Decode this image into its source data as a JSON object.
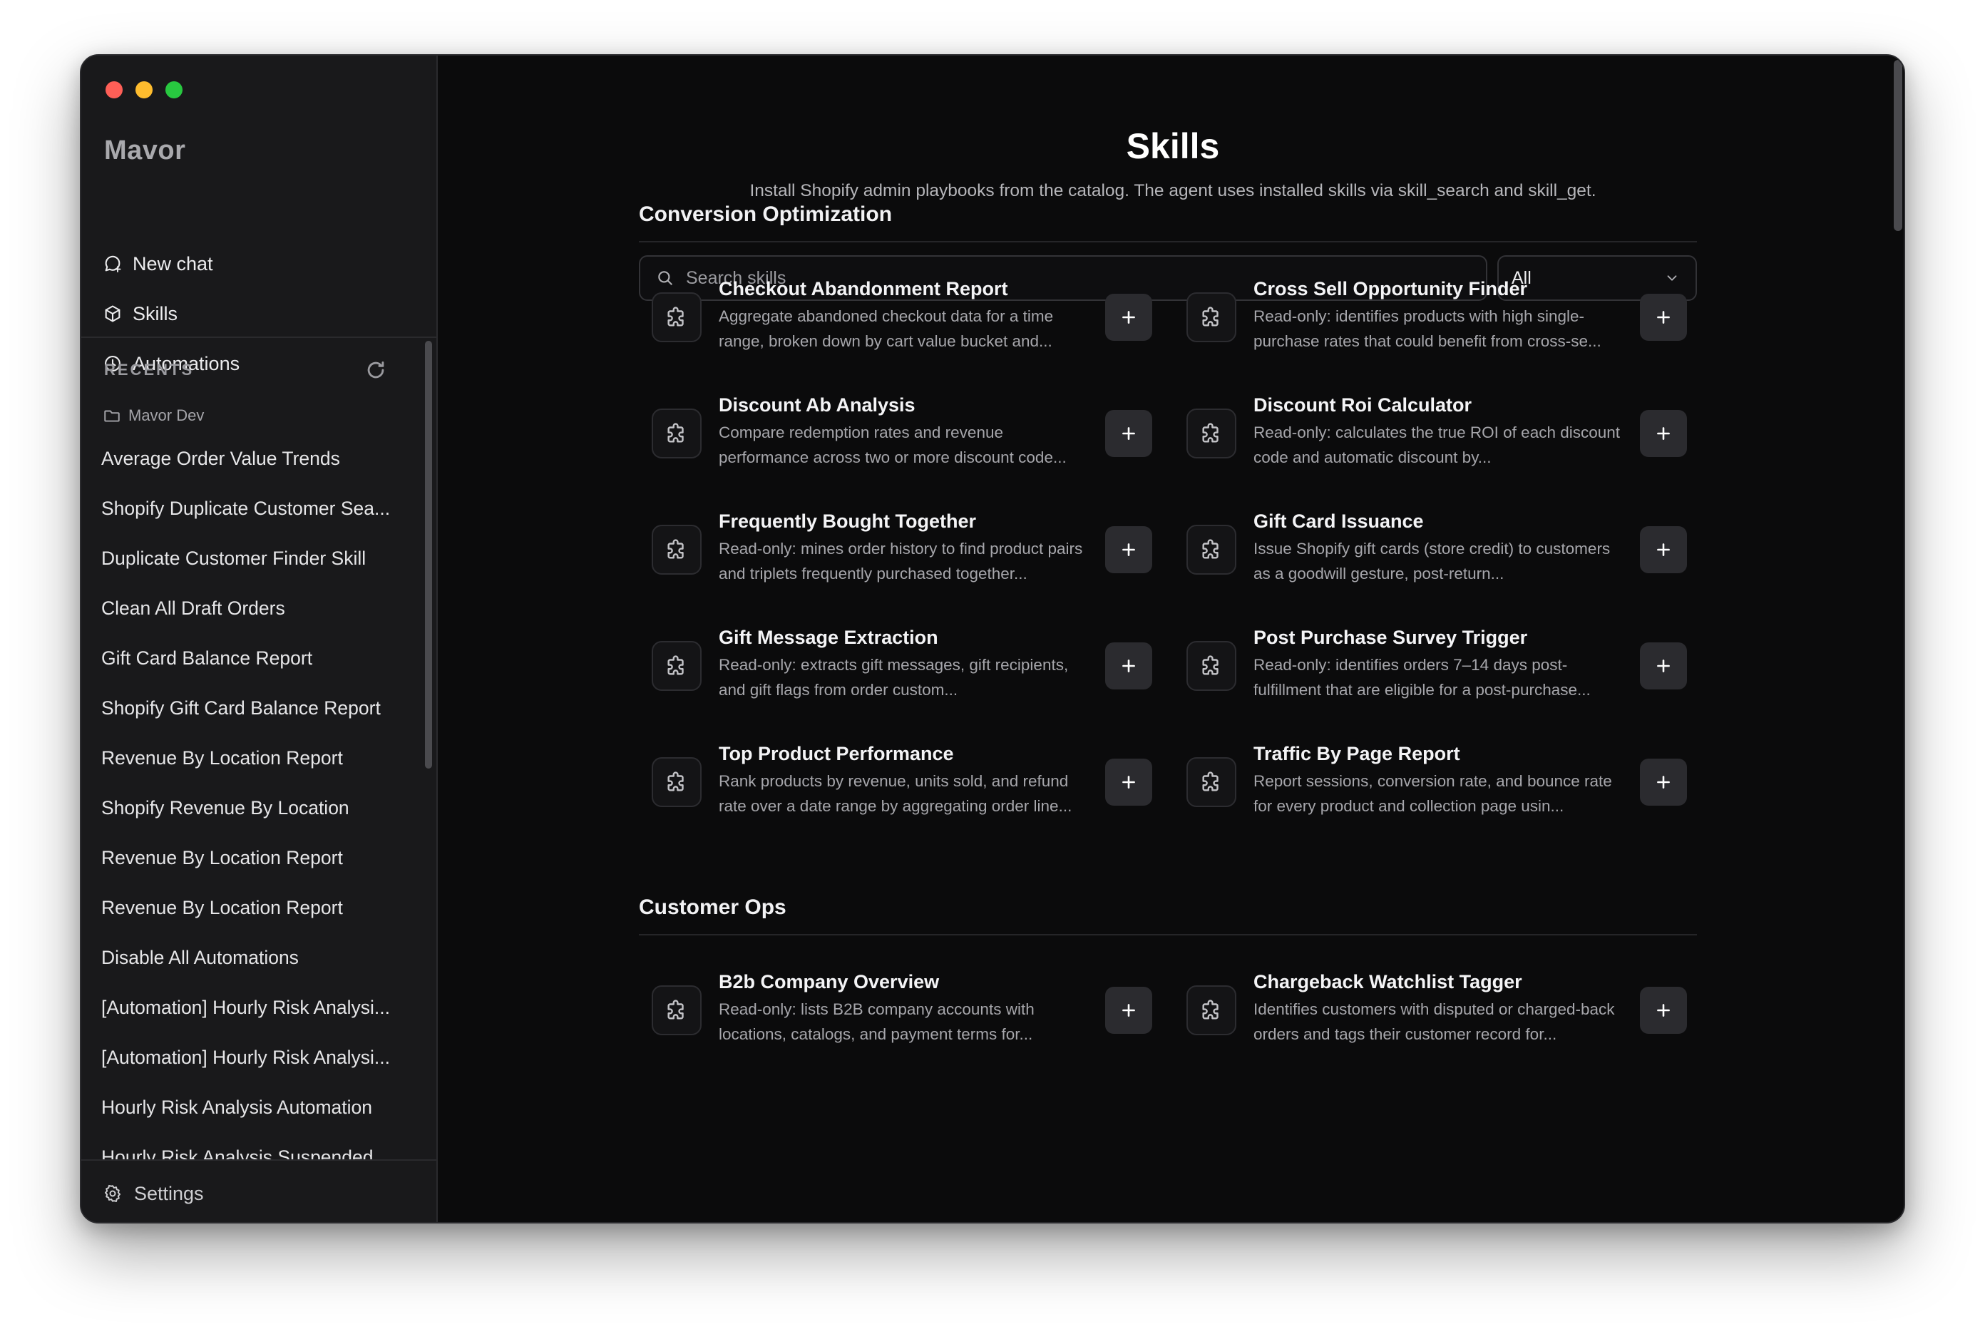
{
  "app": {
    "name": "Mavor"
  },
  "nav": [
    {
      "label": "New chat",
      "icon": "chat-plus-icon"
    },
    {
      "label": "Skills",
      "icon": "package-icon"
    },
    {
      "label": "Automations",
      "icon": "clock-icon"
    }
  ],
  "recents": {
    "label": "RECENTS",
    "folder": "Mavor Dev",
    "items": [
      "Average Order Value Trends",
      "Shopify Duplicate Customer Sea...",
      "Duplicate Customer Finder Skill",
      "Clean All Draft Orders",
      "Gift Card Balance Report",
      "Shopify Gift Card Balance Report",
      "Revenue By Location Report",
      "Shopify Revenue By Location",
      "Revenue By Location Report",
      "Revenue By Location Report",
      "Disable All Automations",
      "[Automation] Hourly Risk Analysi...",
      "[Automation] Hourly Risk Analysi...",
      "Hourly Risk Analysis Automation",
      "Hourly Risk Analysis Suspended"
    ]
  },
  "settings": {
    "label": "Settings"
  },
  "page": {
    "title": "Skills",
    "subtitle": "Install Shopify admin playbooks from the catalog. The agent uses installed skills via skill_search and skill_get."
  },
  "search": {
    "placeholder": "Search skills",
    "value": ""
  },
  "filter": {
    "selected": "All"
  },
  "sections": [
    {
      "title": "Conversion Optimization",
      "skills": [
        {
          "title": "Checkout Abandonment Report",
          "desc": "Aggregate abandoned checkout data for a time range, broken down by cart value bucket and..."
        },
        {
          "title": "Cross Sell Opportunity Finder",
          "desc": "Read-only: identifies products with high single-purchase rates that could benefit from cross-se..."
        },
        {
          "title": "Discount Ab Analysis",
          "desc": "Compare redemption rates and revenue performance across two or more discount code..."
        },
        {
          "title": "Discount Roi Calculator",
          "desc": "Read-only: calculates the true ROI of each discount code and automatic discount by..."
        },
        {
          "title": "Frequently Bought Together",
          "desc": "Read-only: mines order history to find product pairs and triplets frequently purchased together..."
        },
        {
          "title": "Gift Card Issuance",
          "desc": "Issue Shopify gift cards (store credit) to customers as a goodwill gesture, post-return..."
        },
        {
          "title": "Gift Message Extraction",
          "desc": "Read-only: extracts gift messages, gift recipients, and gift flags from order custom..."
        },
        {
          "title": "Post Purchase Survey Trigger",
          "desc": "Read-only: identifies orders 7–14 days post-fulfillment that are eligible for a post-purchase..."
        },
        {
          "title": "Top Product Performance",
          "desc": "Rank products by revenue, units sold, and refund rate over a date range by aggregating order line..."
        },
        {
          "title": "Traffic By Page Report",
          "desc": "Report sessions, conversion rate, and bounce rate for every product and collection page usin..."
        }
      ]
    },
    {
      "title": "Customer Ops",
      "skills": [
        {
          "title": "B2b Company Overview",
          "desc": "Read-only: lists B2B company accounts with locations, catalogs, and payment terms for..."
        },
        {
          "title": "Chargeback Watchlist Tagger",
          "desc": "Identifies customers with disputed or charged-back orders and tags their customer record for..."
        }
      ]
    }
  ],
  "colors": {
    "window_bg": "#0b0b0c",
    "sidebar_bg": "#19191b",
    "text_primary": "#f4f4f6",
    "text_muted": "#a6a6ab",
    "button_bg": "#2b2b2f",
    "traffic_red": "#fe5f57",
    "traffic_yellow": "#febc2e",
    "traffic_green": "#28c840"
  }
}
